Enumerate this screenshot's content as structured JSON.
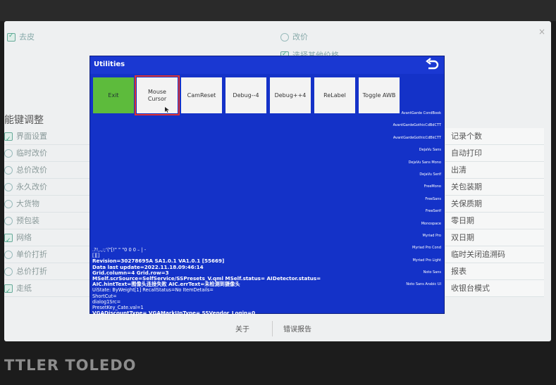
{
  "background_screen": {
    "top_options": {
      "remove_skin": "去皮",
      "change_price": "改价",
      "choose_other_price": "选择其他价格"
    },
    "section_title": "能键调整",
    "left_items": [
      {
        "label": "界面设置",
        "checked": true
      },
      {
        "label": "临时改价",
        "checked": false
      },
      {
        "label": "总价改价",
        "checked": false
      },
      {
        "label": "永久改价",
        "checked": false
      },
      {
        "label": "大货物",
        "checked": false
      },
      {
        "label": "预包装",
        "checked": false
      },
      {
        "label": "网络",
        "checked": true
      },
      {
        "label": "单价打折",
        "checked": false
      },
      {
        "label": "总价打折",
        "checked": false
      },
      {
        "label": "走纸",
        "checked": true
      }
    ],
    "right_items": [
      "记录个数",
      "自动打印",
      "出清",
      "关包装期",
      "关保质期",
      "零日期",
      "双日期",
      "临时关闭追溯码",
      "报表",
      "收银台模式"
    ],
    "bottom": {
      "about": "关于",
      "error_report": "错误报告"
    }
  },
  "utilities": {
    "title": "Utilities",
    "buttons": [
      {
        "label": "Exit"
      },
      {
        "label": "Mouse Cursor",
        "selected": true
      },
      {
        "label": "CamReset"
      },
      {
        "label": "Debug--4"
      },
      {
        "label": "Debug++4"
      },
      {
        "label": "ReLabel"
      },
      {
        "label": "Toggle AWB"
      }
    ],
    "fonts": [
      "AvantGarde CondBook",
      "AvantGardeGothicCdBdCTT",
      "AvantGardeGothicCdBkCTT",
      "DejaVu Sans",
      "DejaVu Sans Mono",
      "DejaVu Serif",
      "FreeMono",
      "FreeSans",
      "FreeSerif",
      "Monospace",
      "Myriad Pro",
      "Myriad Pro Cond",
      "Myriad Pro Light",
      "Noto Sans",
      "Noto Sans Arabic UI"
    ],
    "info_lines": [
      ".?!,.,:;‘(\"[!\" \" \"0 0 0 – | -",
      "[][]",
      "Revision=30278695A SA1.0.1 VA1.0.1 [55669]",
      "Data last update=2022.11.18.09:46:14",
      "Grid.column=4 Grid.row=3",
      "MSelf.scrSource=SelfService/SSPresets_V.qml MSelf.status= AIDetector.status=",
      "AIC.hintText=图像头连接失败 AIC.errText=未检测到摄像头",
      "UiState: ByWeight[1] RecallStatus=No ItemDetails=",
      "ShortCut=",
      "dialog1Src=",
      "PresetKey_Cate.val=1",
      "VGADiscountType= VGAMarkUpType= SSVendor_Login=0"
    ]
  },
  "bezel_brand": "TTLER TOLEDO"
}
